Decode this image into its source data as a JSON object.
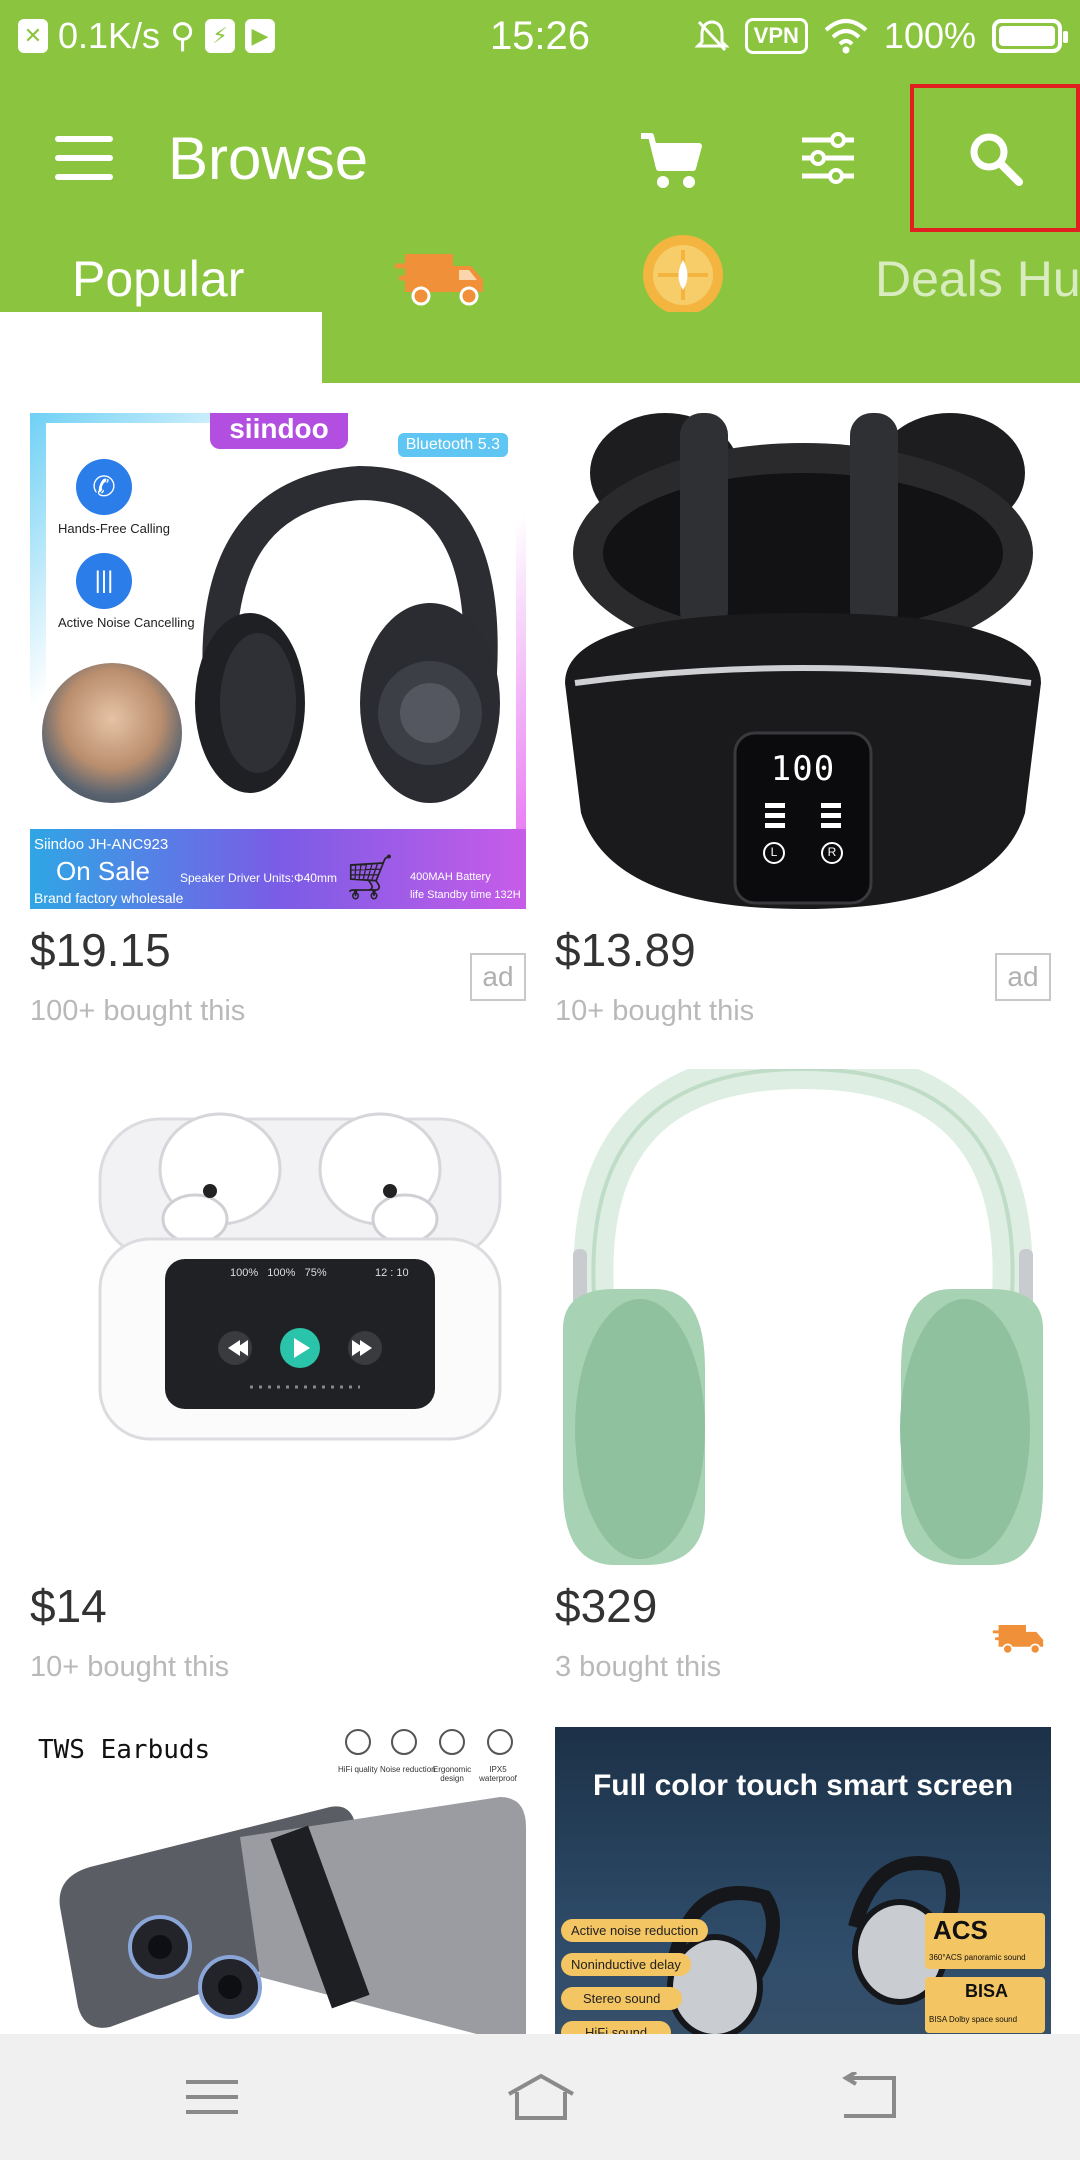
{
  "status_bar": {
    "speed": "0.1K/s",
    "time": "15:26",
    "vpn": "VPN",
    "battery": "100%"
  },
  "app_bar": {
    "title": "Browse",
    "icons": [
      "menu-icon",
      "cart-icon",
      "filter-icon",
      "search-icon"
    ]
  },
  "tabs": {
    "items": [
      {
        "label": "Popular",
        "selected": true
      },
      {
        "label": "",
        "icon": "delivery-truck-icon"
      },
      {
        "label": "",
        "icon": "coin-icon"
      },
      {
        "label": "Deals Hub"
      }
    ]
  },
  "colors": {
    "primary": "#8bc53f",
    "highlight_border": "#e02020",
    "truck": "#f0913a"
  },
  "products": [
    {
      "price": "$19.15",
      "bought": "100+ bought this",
      "badge": "ad",
      "image": {
        "brand": "siindoo",
        "bluetooth": "Bluetooth 5.3",
        "feature_1": "Hands-Free Calling",
        "feature_2": "Active Noise Cancelling",
        "model": "Siindoo JH-ANC923",
        "sale": "On Sale",
        "wholesale": "Brand factory wholesale",
        "driver": "Speaker Driver Units:Φ40mm",
        "battery": "400MAH Battery",
        "standby": "life Standby time 132H"
      }
    },
    {
      "price": "$13.89",
      "bought": "10+ bought this",
      "badge": "ad",
      "image": {
        "display": "100",
        "left": "L",
        "right": "R"
      }
    },
    {
      "price": "$14",
      "bought": "10+ bought this",
      "image": {
        "status": "100%   100%   75%",
        "clock": "12 : 10"
      }
    },
    {
      "price": "$329",
      "bought": "3 bought this",
      "badge_icon": "delivery-truck-icon"
    },
    {
      "image": {
        "title": "TWS Earbuds",
        "f1": "HiFi quality",
        "f2": "Noise reduction",
        "f3": "Ergonomic design",
        "f4": "IPX5 waterproof"
      }
    },
    {
      "image": {
        "title": "Full color touch smart screen",
        "p1": "Active noise reduction",
        "p2": "Noninductive delay",
        "p3": "Stereo sound",
        "p4": "HiFi sound",
        "acs": "ACS",
        "acs_sub": "360°ACS panoramic sound",
        "bisa": "BISA",
        "bisa_sub": "BISA Dolby space sound"
      }
    }
  ],
  "nav_bar": {
    "icons": [
      "recent-apps-icon",
      "home-icon",
      "back-icon"
    ]
  }
}
